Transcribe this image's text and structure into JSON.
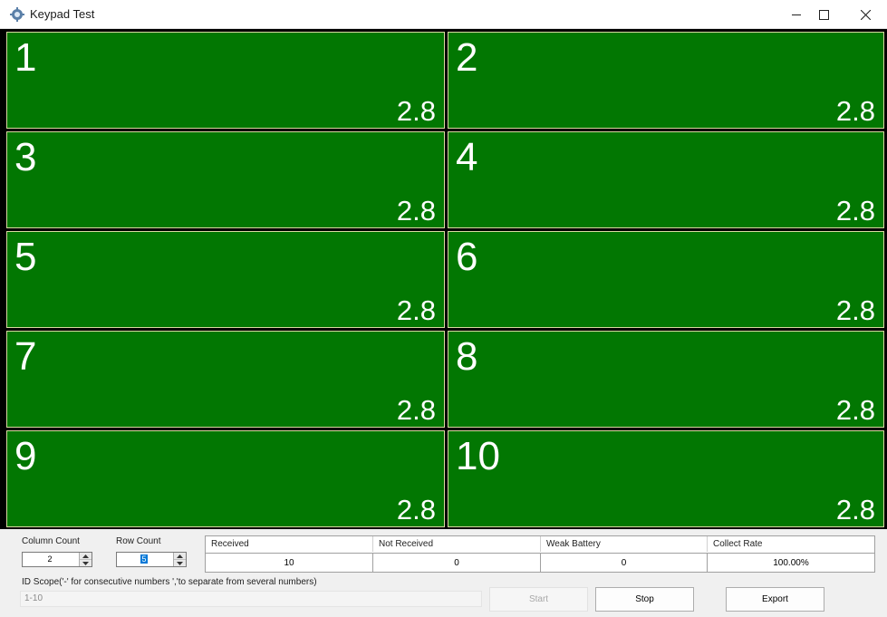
{
  "window": {
    "title": "Keypad Test",
    "icon": "gear-icon",
    "controls": [
      "minimize-icon",
      "maximize-icon",
      "close-icon"
    ]
  },
  "grid": {
    "cell_color": "#027702",
    "cells": [
      {
        "id": "1",
        "value": "2.8"
      },
      {
        "id": "2",
        "value": "2.8"
      },
      {
        "id": "3",
        "value": "2.8"
      },
      {
        "id": "4",
        "value": "2.8"
      },
      {
        "id": "5",
        "value": "2.8"
      },
      {
        "id": "6",
        "value": "2.8"
      },
      {
        "id": "7",
        "value": "2.8"
      },
      {
        "id": "8",
        "value": "2.8"
      },
      {
        "id": "9",
        "value": "2.8"
      },
      {
        "id": "10",
        "value": "2.8"
      }
    ]
  },
  "settings": {
    "column_count_label": "Column Count",
    "column_count": "2",
    "row_count_label": "Row Count",
    "row_count": "5"
  },
  "stats": {
    "headers": [
      "Received",
      "Not Received",
      "Weak Battery",
      "Collect Rate"
    ],
    "values": [
      "10",
      "0",
      "0",
      "100.00%"
    ]
  },
  "scope": {
    "label": "ID Scope('-' for consecutive numbers ','to separate from several numbers)",
    "value": "1-10"
  },
  "buttons": {
    "start": "Start",
    "stop": "Stop",
    "export": "Export"
  }
}
